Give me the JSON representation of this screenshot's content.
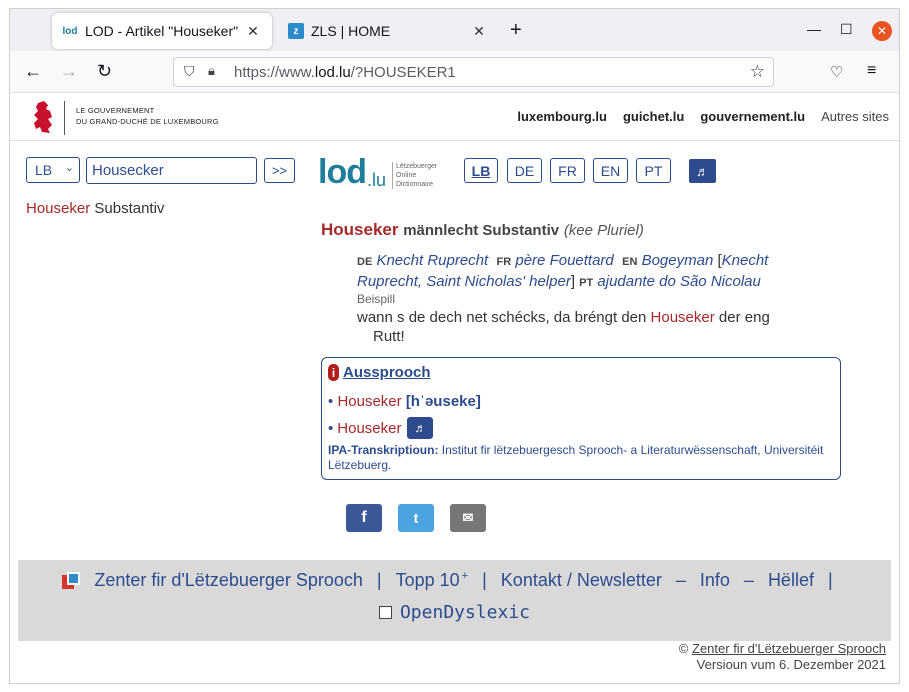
{
  "browser": {
    "tabs": [
      {
        "title": "LOD - Artikel \"Houseker\"",
        "icon": "lod-favicon"
      },
      {
        "title": "ZLS | HOME",
        "icon": "zls-favicon"
      }
    ],
    "url_prefix": "https://www.",
    "url_domain": "lod.lu",
    "url_path": "/?HOUSEKER1"
  },
  "gov": {
    "line1": "LE GOUVERNEMENT",
    "line2": "DU GRAND-DUCHÉ DE LUXEMBOURG",
    "links": [
      "luxembourg.lu",
      "guichet.lu",
      "gouvernement.lu"
    ],
    "other": "Autres sites"
  },
  "search": {
    "lang_value": "LB",
    "query": "Housecker",
    "go_label": ">>"
  },
  "logo": {
    "lod": "lod",
    "lu": ".lu",
    "sub1": "Lëtzebuerger",
    "sub2": "Online",
    "sub3": "Dictionnaire"
  },
  "ui_langs": [
    "LB",
    "DE",
    "FR",
    "EN",
    "PT"
  ],
  "ui_lang_active": "LB",
  "audio_icon": "♬",
  "result": {
    "word": "Houseker",
    "pos": "Substantiv"
  },
  "article": {
    "headword": "Houseker",
    "pos": "männlecht Substantiv",
    "plural": "(kee Pluriel)",
    "translations": {
      "de_code": "DE",
      "de": "Knecht Ruprecht",
      "fr_code": "FR",
      "fr": "père Fouettard",
      "en_code": "EN",
      "en": "Bogeyman",
      "en_alt": "Knecht Ruprecht, Saint Nicholas' helper",
      "pt_code": "PT",
      "pt": "ajudante do São Nicolau"
    },
    "example_label": "Beispill",
    "example_before": "wann s de dech net schécks, da bréngt den",
    "example_word": "Houseker",
    "example_after": "der eng",
    "example_cont": "Rutt!"
  },
  "aussprooch": {
    "badge": "i",
    "title": "Aussprooch",
    "bullet": "•",
    "word": "Houseker",
    "ipa": "[hˈəuseke]",
    "sound_icon": "♬",
    "credit_label": "IPA-Transkriptioun:",
    "credit_text": "Institut fir lëtzebuergesch Sprooch- a Literaturwëssenschaft, Universitéit Lëtzebuerg."
  },
  "share": {
    "facebook": "f",
    "twitter": "t",
    "mail": "✉"
  },
  "footer": {
    "zls": "Zenter fir d'Lëtzebuerger Sprooch",
    "sep1": "|",
    "top10": "Topp 10",
    "top10_plus": "+",
    "sep2": "|",
    "kontakt": "Kontakt / Newsletter",
    "sep3": "–",
    "info": "Info",
    "sep4": "–",
    "hellef": "Hëllef",
    "sep5": "|",
    "dyslexic": "OpenDyslexic"
  },
  "copyright": {
    "prefix": "©",
    "link": "Zenter fir d'Lëtzebuerger Sprooch",
    "version": "Versioun vum 6. Dezember 2021"
  },
  "colors": {
    "accent": "#2d4c8e",
    "headword": "#a52a2a",
    "footer_bg": "#d9d9d9",
    "close_button": "#e95420"
  }
}
